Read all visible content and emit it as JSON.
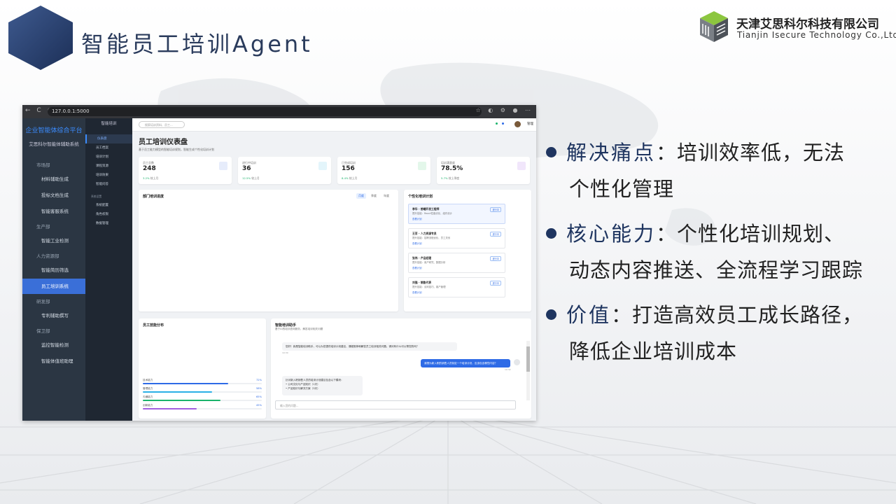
{
  "slide": {
    "title": "智能员工培训Agent",
    "company_cn": "天津艾思科尔科技有限公司",
    "company_en": "Tianjin Isecure Technology Co.,Ltd",
    "accent_color": "#1f3560",
    "logo_icon": "cube-logo-icon"
  },
  "bullets": [
    {
      "keyword": "解决痛点",
      "text_line1": "：培训效率低，无法",
      "text_line2": "个性化管理"
    },
    {
      "keyword": "核心能力",
      "text_line1": "：个性化培训规划、",
      "text_line2": "动态内容推送、全流程学习跟踪"
    },
    {
      "keyword": "价值",
      "text_line1": "：打造高效员工成长路径，",
      "text_line2": "降低企业培训成本"
    }
  ],
  "screenshot": {
    "browser": {
      "url": "127.0.0.1:5000",
      "nav": "← C ⊙",
      "icons": "☆ ◐ ⚙ ● ⋯"
    },
    "platform_title": "企业智能体综合平台",
    "platform_sub": "艾思科尔智能体辅助系统",
    "sidebar": [
      {
        "type": "section",
        "label": "市场部"
      },
      {
        "type": "item",
        "label": "材料辅助生成"
      },
      {
        "type": "item",
        "label": "投标文档生成"
      },
      {
        "type": "item",
        "label": "智能客服系统"
      },
      {
        "type": "section",
        "label": "生产部"
      },
      {
        "type": "item",
        "label": "智能工业检测"
      },
      {
        "type": "section",
        "label": "人力资源部"
      },
      {
        "type": "item",
        "label": "智能简历筛选"
      },
      {
        "type": "item",
        "label": "员工培训系统",
        "active": true
      },
      {
        "type": "section",
        "label": "研发部"
      },
      {
        "type": "item",
        "label": "专利辅助撰写"
      },
      {
        "type": "section",
        "label": "保卫部"
      },
      {
        "type": "item",
        "label": "监控智能检测"
      },
      {
        "type": "item",
        "label": "智能体值班助理"
      }
    ],
    "sub_sidebar": {
      "header": "智能培训",
      "items": [
        {
          "label": "仪表盘",
          "active": true
        },
        {
          "label": "员工档案"
        },
        {
          "label": "培训计划"
        },
        {
          "label": "课程资源"
        },
        {
          "label": "培训效果"
        },
        {
          "label": "智能问答"
        },
        {
          "label": "系统设置",
          "small": true
        },
        {
          "label": "系统配置"
        },
        {
          "label": "角色权限"
        },
        {
          "label": "数据管理"
        }
      ]
    },
    "topbar": {
      "search_placeholder": "搜索培训资料、员工...",
      "user": "管理"
    },
    "page_title": "员工培训仪表盘",
    "page_subtitle": "基于员工能力模型的智能培训规划，智能生成个性化培训计划",
    "stats": [
      {
        "label": "员工总数",
        "value": "248",
        "change": "3.2%",
        "suffix": "较上月",
        "color": "#e6ecfb"
      },
      {
        "label": "进行中培训",
        "value": "36",
        "change": "12.5%",
        "suffix": "较上月",
        "color": "#e3f5fb"
      },
      {
        "label": "已完成培训",
        "value": "156",
        "change": "8.4%",
        "suffix": "较上月",
        "color": "#e3f7ea"
      },
      {
        "label": "培训满意度",
        "value": "78.5%",
        "change": "5.7%",
        "suffix": "较上季度",
        "color": "#f1e6fb"
      }
    ],
    "dept_card": {
      "title": "部门培训进度",
      "tabs": [
        "月度",
        "季度",
        "年度"
      ]
    },
    "plan_card": {
      "title": "个性化培训计划",
      "plans": [
        {
          "name": "李华 - 前端开发工程师",
          "desc": "提升技能：React性能优化、组件设计",
          "link": "查看计划",
          "badge": "进行中"
        },
        {
          "name": "王芳 - 人力资源专员",
          "desc": "提升技能：招聘流程优化、员工关系",
          "link": "查看计划",
          "badge": "进行中"
        },
        {
          "name": "张伟 - 产品经理",
          "desc": "提升技能：用户研究、数据分析",
          "link": "查看计划",
          "badge": "进行中"
        },
        {
          "name": "刘强 - 销售代表",
          "desc": "提升技能：谈判技巧、客户管理",
          "link": "查看计划",
          "badge": "进行中"
        }
      ]
    },
    "skill_card": {
      "title": "员工技能分布",
      "bars": [
        {
          "label": "技术能力",
          "pct": "72%",
          "value": 0.72,
          "color": "#2e6be6"
        },
        {
          "label": "管理能力",
          "pct": "58%",
          "value": 0.58,
          "color": "#2bb0e6"
        },
        {
          "label": "沟通能力",
          "pct": "65%",
          "value": 0.65,
          "color": "#1bb36c"
        },
        {
          "label": "创新能力",
          "pct": "45%",
          "value": 0.45,
          "color": "#a35ee0"
        }
      ]
    },
    "chat_card": {
      "title": "智能培训助手",
      "subtitle": "基于AI的培训咨询服务，解答培训相关问题",
      "bot_msg": "您好！我是智能培训助手，可以为您提供培训计划建议、课程推荐和解答员工培训相关问题。请问有什么可以帮您的吗？",
      "bot_time": "10:30",
      "user_msg": "我想为新入职的销售人员制定一个培训计划，应该包含哪些内容？",
      "user_time": "10:32",
      "bot_reply": "针对新入职销售人员的培训计划建议包含以下模块：",
      "reply_items": [
        "公司文化与产品知识（1天）",
        "产品知识与解决方案（3天）"
      ],
      "input_placeholder": "输入您的问题..."
    }
  }
}
